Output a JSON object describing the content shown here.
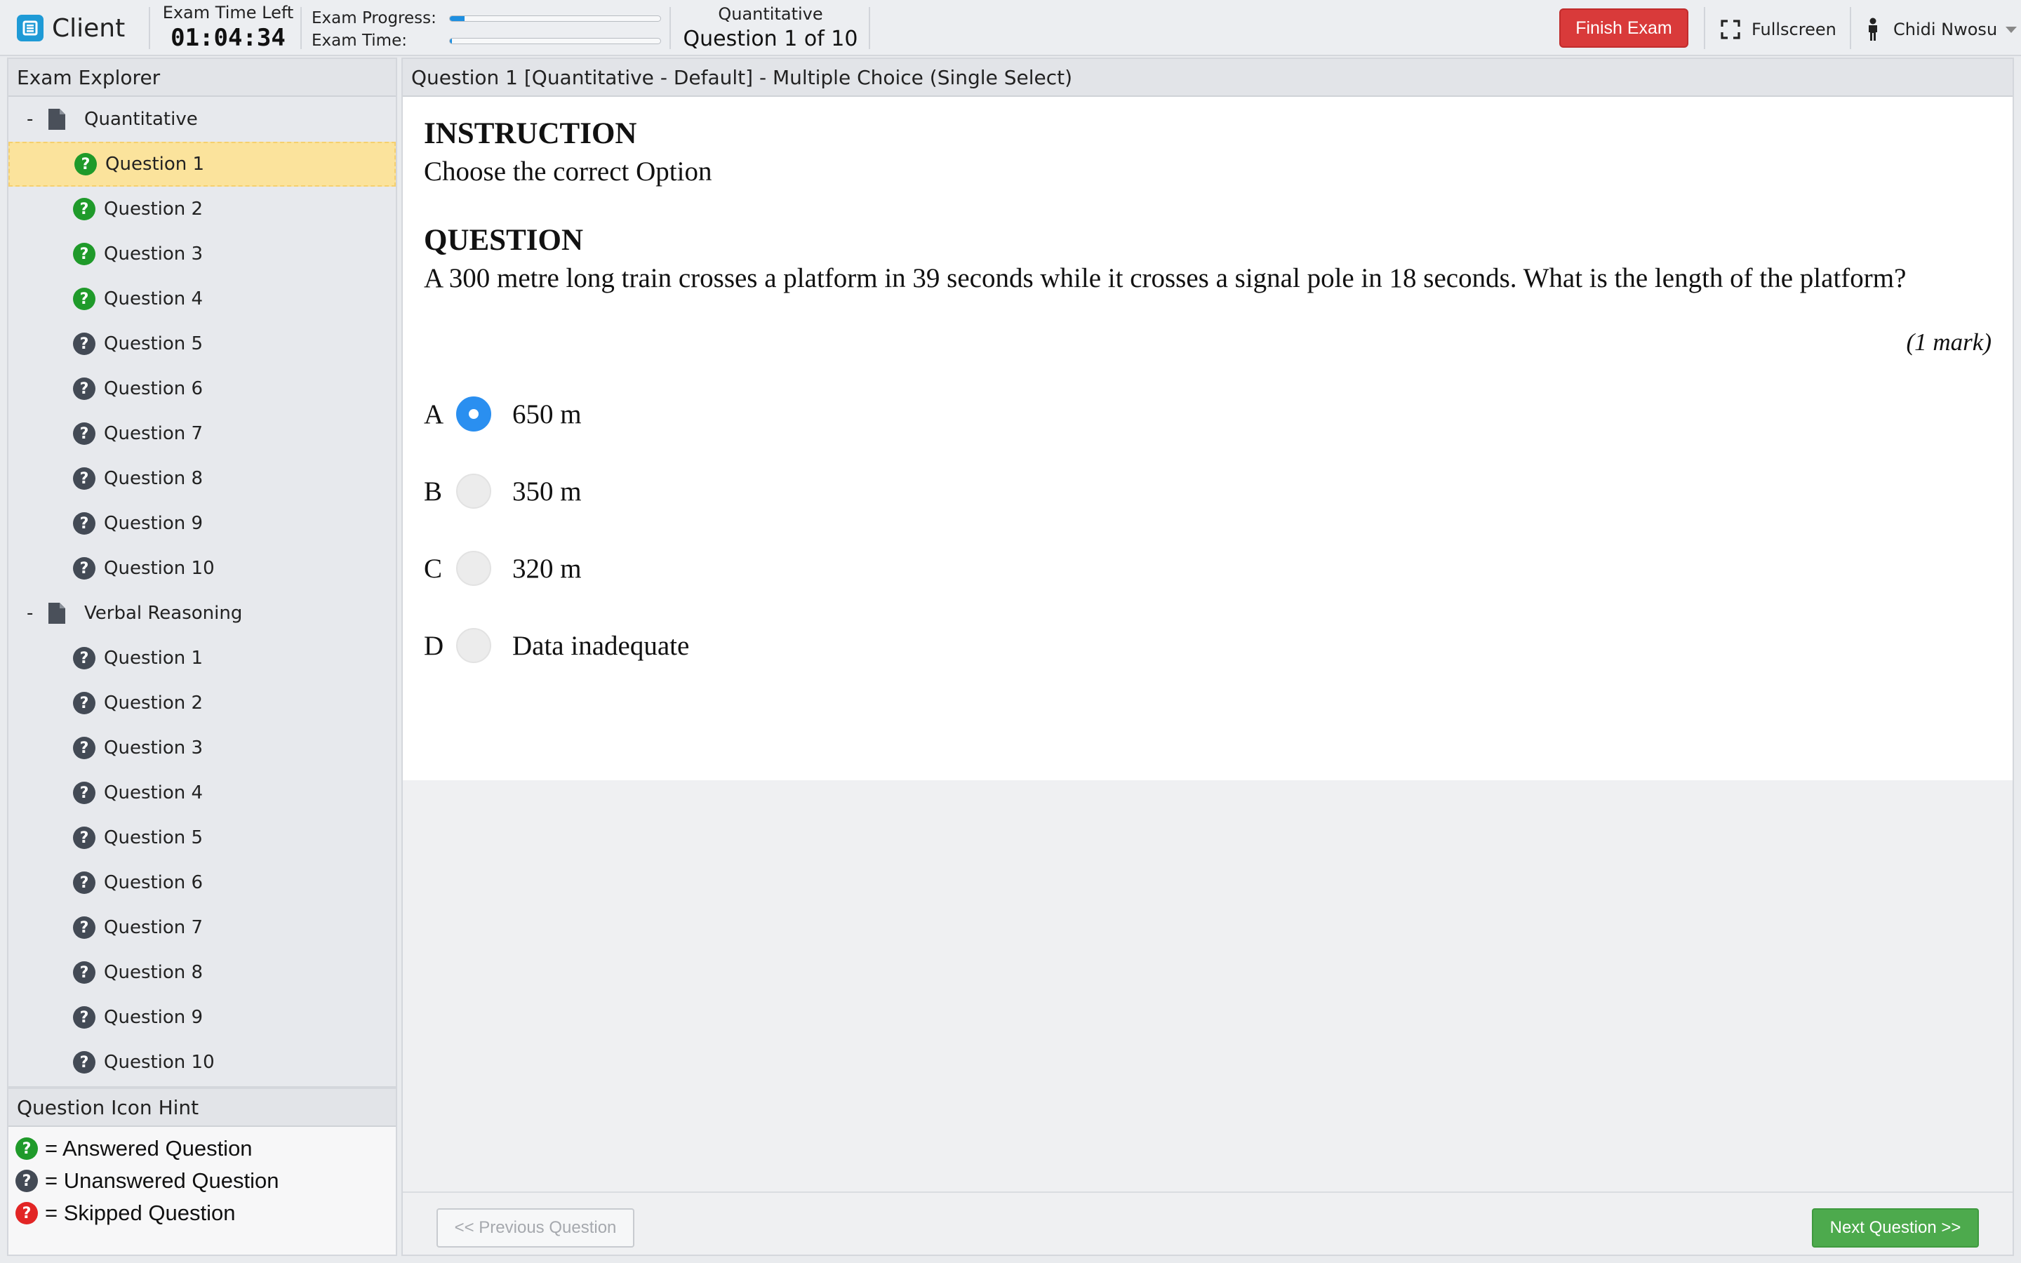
{
  "header": {
    "brand": "Client",
    "time_left_label": "Exam Time Left",
    "time_left": "01:04:34",
    "progress_label": "Exam Progress:",
    "progress_fraction": 0.07,
    "exam_time_label": "Exam Time:",
    "exam_time_fraction": 0.01,
    "section": "Quantitative",
    "question_counter": "Question 1 of 10",
    "finish_label": "Finish Exam",
    "fullscreen_label": "Fullscreen",
    "user_name": "Chidi Nwosu"
  },
  "sidebar": {
    "title": "Exam Explorer",
    "sections": [
      {
        "name": "Quantitative",
        "toggle": "-",
        "questions": [
          {
            "label": "Question 1",
            "status": "answered",
            "active": true
          },
          {
            "label": "Question 2",
            "status": "answered"
          },
          {
            "label": "Question 3",
            "status": "answered"
          },
          {
            "label": "Question 4",
            "status": "answered"
          },
          {
            "label": "Question 5",
            "status": "unanswered"
          },
          {
            "label": "Question 6",
            "status": "unanswered"
          },
          {
            "label": "Question 7",
            "status": "unanswered"
          },
          {
            "label": "Question 8",
            "status": "unanswered"
          },
          {
            "label": "Question 9",
            "status": "unanswered"
          },
          {
            "label": "Question 10",
            "status": "unanswered"
          }
        ]
      },
      {
        "name": "Verbal Reasoning",
        "toggle": "-",
        "questions": [
          {
            "label": "Question 1",
            "status": "unanswered"
          },
          {
            "label": "Question 2",
            "status": "unanswered"
          },
          {
            "label": "Question 3",
            "status": "unanswered"
          },
          {
            "label": "Question 4",
            "status": "unanswered"
          },
          {
            "label": "Question 5",
            "status": "unanswered"
          },
          {
            "label": "Question 6",
            "status": "unanswered"
          },
          {
            "label": "Question 7",
            "status": "unanswered"
          },
          {
            "label": "Question 8",
            "status": "unanswered"
          },
          {
            "label": "Question 9",
            "status": "unanswered"
          },
          {
            "label": "Question 10",
            "status": "unanswered"
          }
        ]
      }
    ]
  },
  "hint": {
    "title": "Question Icon Hint",
    "items": [
      {
        "status": "answered",
        "text": "= Answered Question"
      },
      {
        "status": "unanswered",
        "text": "= Unanswered Question"
      },
      {
        "status": "skipped",
        "text": "= Skipped Question"
      }
    ]
  },
  "main": {
    "header": "Question 1 [Quantitative - Default] - Multiple Choice (Single Select)",
    "instruction_heading": "INSTRUCTION",
    "instruction_text": "Choose the correct Option",
    "question_heading": "QUESTION",
    "question_text": "A 300 metre long train crosses a platform in 39 seconds while it crosses a signal pole in 18 seconds. What is the length of the platform?",
    "mark": "(1 mark)",
    "options": [
      {
        "letter": "A",
        "text": "650 m",
        "selected": true
      },
      {
        "letter": "B",
        "text": "350 m",
        "selected": false
      },
      {
        "letter": "C",
        "text": "320 m",
        "selected": false
      },
      {
        "letter": "D",
        "text": "Data inadequate",
        "selected": false
      }
    ],
    "prev_label": "<< Previous Question",
    "next_label": "Next Question >>"
  },
  "colors": {
    "answered": "#1f9a2a",
    "unanswered": "#434a55",
    "skipped": "#e22525",
    "accent": "#2a8ff0",
    "finish": "#d93a3a",
    "next": "#4daa4d",
    "active_row": "#fbe39c"
  },
  "icons": {
    "brand": "app-logo-icon",
    "fullscreen": "fullscreen-icon",
    "user": "user-icon",
    "section": "document-icon",
    "question": "question-circle-icon",
    "dropdown": "chevron-down-icon"
  }
}
